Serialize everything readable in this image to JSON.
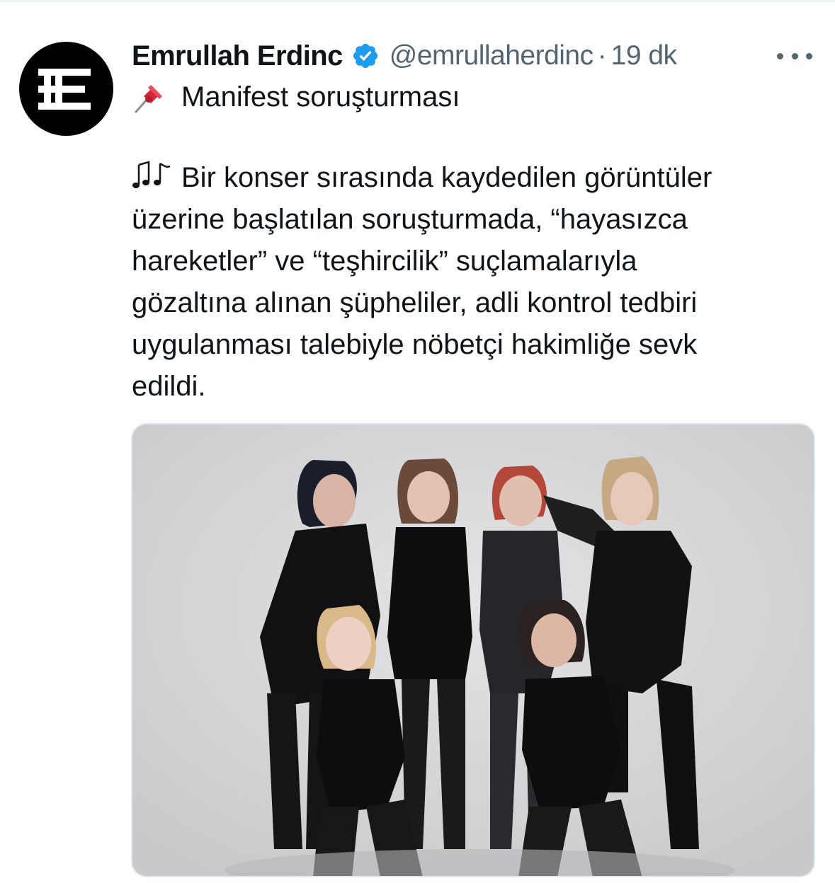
{
  "author": {
    "display_name": "Emrullah Erdinc",
    "handle": "@emrullaherdinc",
    "separator": "·",
    "time": "19 dk",
    "verified": true,
    "avatar_letter": "E",
    "verified_color": "#1d9bf0"
  },
  "icons": {
    "verified": "verified-badge-icon",
    "more": "more-horizontal-icon",
    "pin": "pushpin-emoji",
    "notes": "musical-notes-emoji"
  },
  "tweet": {
    "subject": "Manifest soruşturması",
    "body_lines": [
      "Bir konser sırasında kaydedilen görüntüler",
      "üzerine başlatılan soruşturmada, “hayasızca",
      "hareketler” ve “teşhircilik” suçlamalarıyla",
      "gözaltına alınan şüpheliler, adli kontrol tedbiri",
      "uygulanması talebiyle nöbetçi hakimliğe sevk",
      "edildi."
    ]
  },
  "colors": {
    "text_primary": "#0f1419",
    "text_secondary": "#536471",
    "accent": "#1d9bf0"
  }
}
